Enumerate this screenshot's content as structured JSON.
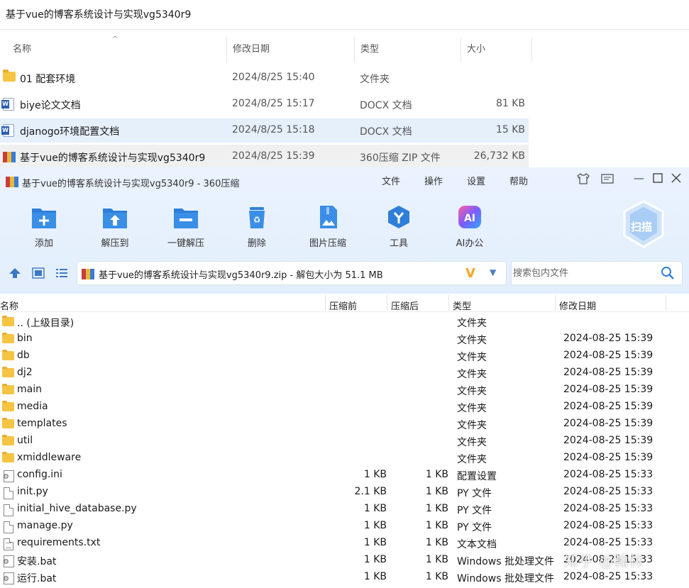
{
  "explorer": {
    "title": "基于vue的博客系统设计与实现vg5340r9",
    "columns": {
      "name": "名称",
      "date": "修改日期",
      "type": "类型",
      "size": "大小"
    },
    "rows": [
      {
        "name": "01 配套环境",
        "date": "2024/8/25 15:40",
        "type": "文件夹",
        "size": "",
        "icon": "folder-icon"
      },
      {
        "name": "biye论文文档",
        "date": "2024/8/25 15:17",
        "type": "DOCX 文档",
        "size": "81 KB",
        "icon": "word-doc-icon"
      },
      {
        "name": "djanogo环境配置文档",
        "date": "2024/8/25 15:18",
        "type": "DOCX 文档",
        "size": "15 KB",
        "icon": "word-doc-icon"
      },
      {
        "name": "基于vue的博客系统设计与实现vg5340r9",
        "date": "2024/8/25 15:39",
        "type": "360压缩 ZIP 文件",
        "size": "26,732 KB",
        "icon": "zip-archive-icon"
      }
    ]
  },
  "zip_window": {
    "title": "基于vue的博客系统设计与实现vg5340r9 - 360压缩",
    "menu": [
      "文件",
      "操作",
      "设置",
      "帮助"
    ],
    "toolbar": [
      "添加",
      "解压到",
      "一键解压",
      "删除",
      "图片压缩",
      "工具",
      "AI办公"
    ],
    "scan_label": "扫描",
    "path": "基于vue的博客系统设计与实现vg5340r9.zip - 解包大小为 51.1 MB",
    "search_placeholder": "搜索包内文件",
    "colors": {
      "accent": "#2f7fd8",
      "toolbar_bg": "#e6f0fc",
      "folder": "#f5c443"
    },
    "list_headers": {
      "name": "名称",
      "before": "压缩前",
      "after": "压缩后",
      "type": "类型",
      "date": "修改日期"
    },
    "files": [
      {
        "name": ".. (上级目录)",
        "before": "",
        "after": "",
        "type": "文件夹",
        "date": "",
        "icon": "folder-icon"
      },
      {
        "name": "bin",
        "before": "",
        "after": "",
        "type": "文件夹",
        "date": "2024-08-25 15:39",
        "icon": "folder-icon"
      },
      {
        "name": "db",
        "before": "",
        "after": "",
        "type": "文件夹",
        "date": "2024-08-25 15:39",
        "icon": "folder-icon"
      },
      {
        "name": "dj2",
        "before": "",
        "after": "",
        "type": "文件夹",
        "date": "2024-08-25 15:39",
        "icon": "folder-icon"
      },
      {
        "name": "main",
        "before": "",
        "after": "",
        "type": "文件夹",
        "date": "2024-08-25 15:39",
        "icon": "folder-icon"
      },
      {
        "name": "media",
        "before": "",
        "after": "",
        "type": "文件夹",
        "date": "2024-08-25 15:39",
        "icon": "folder-icon"
      },
      {
        "name": "templates",
        "before": "",
        "after": "",
        "type": "文件夹",
        "date": "2024-08-25 15:39",
        "icon": "folder-icon"
      },
      {
        "name": "util",
        "before": "",
        "after": "",
        "type": "文件夹",
        "date": "2024-08-25 15:39",
        "icon": "folder-icon"
      },
      {
        "name": "xmiddleware",
        "before": "",
        "after": "",
        "type": "文件夹",
        "date": "2024-08-25 15:39",
        "icon": "folder-icon"
      },
      {
        "name": "config.ini",
        "before": "1 KB",
        "after": "1 KB",
        "type": "配置设置",
        "date": "2024-08-25 15:33",
        "icon": "config-file-icon"
      },
      {
        "name": "init.py",
        "before": "2.1 KB",
        "after": "1 KB",
        "type": "PY 文件",
        "date": "2024-08-25 15:33",
        "icon": "file-icon"
      },
      {
        "name": "initial_hive_database.py",
        "before": "1 KB",
        "after": "1 KB",
        "type": "PY 文件",
        "date": "2024-08-25 15:33",
        "icon": "file-icon"
      },
      {
        "name": "manage.py",
        "before": "1 KB",
        "after": "1 KB",
        "type": "PY 文件",
        "date": "2024-08-25 15:33",
        "icon": "file-icon"
      },
      {
        "name": "requirements.txt",
        "before": "1 KB",
        "after": "1 KB",
        "type": "文本文档",
        "date": "2024-08-25 15:33",
        "icon": "text-file-icon"
      },
      {
        "name": "安装.bat",
        "before": "1 KB",
        "after": "1 KB",
        "type": "Windows 批处理文件",
        "date": "2024-08-25 15:33",
        "icon": "batch-file-icon"
      },
      {
        "name": "运行.bat",
        "before": "1 KB",
        "after": "1 KB",
        "type": "Windows 批处理文件",
        "date": "2024-08-25 15:33",
        "icon": "batch-file-icon"
      }
    ]
  },
  "watermark": "知乎 @翰林"
}
